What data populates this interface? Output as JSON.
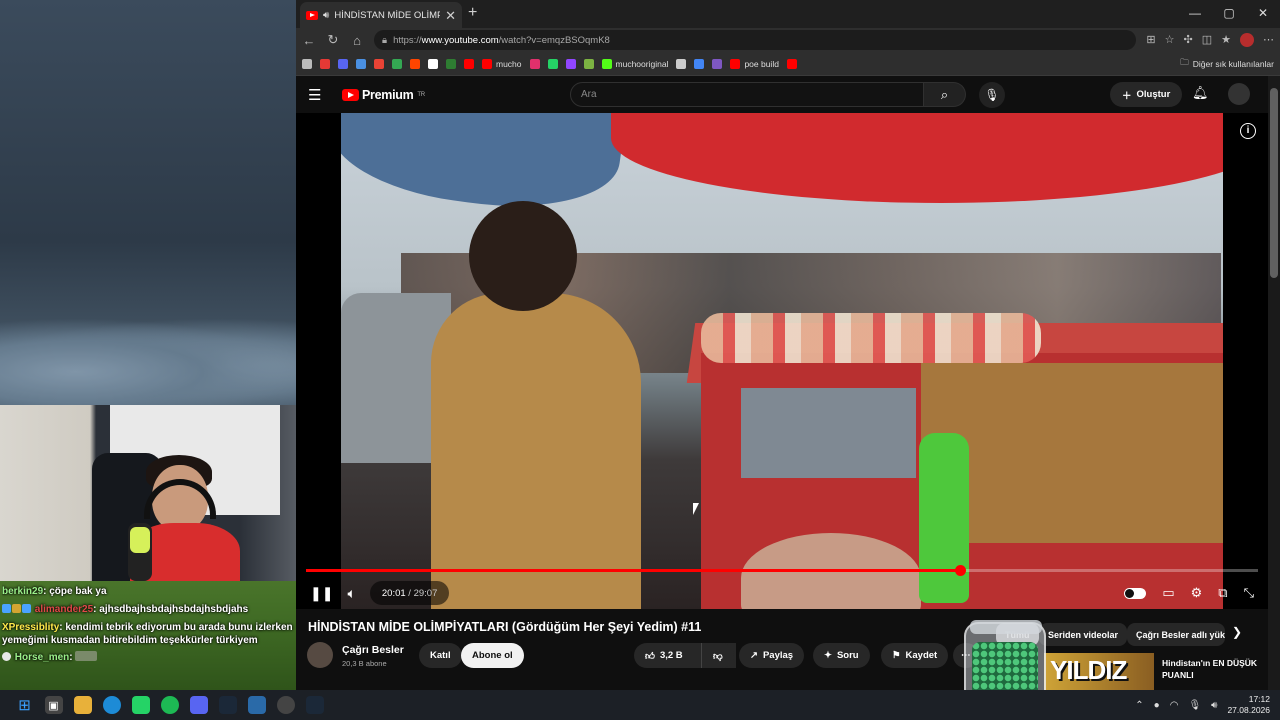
{
  "browser": {
    "tab_title": "HİNDİSTAN MİDE OLİMPİYATL",
    "tab_close": "✕",
    "new_tab": "+",
    "url_prefix": "https://",
    "url_domain": "www.youtube.com",
    "url_path": "/watch?v=emqzBSOqmK8",
    "bookmarks": [
      {
        "label": "",
        "color": "#bbbbbb"
      },
      {
        "label": "",
        "color": "#e53935"
      },
      {
        "label": "",
        "color": "#5865f2"
      },
      {
        "label": "",
        "color": "#4a90e2"
      },
      {
        "label": "",
        "color": "#ea4335"
      },
      {
        "label": "",
        "color": "#34a853"
      },
      {
        "label": "",
        "color": "#ff4500"
      },
      {
        "label": "",
        "color": "#ffffff"
      },
      {
        "label": "",
        "color": "#2e7d32"
      },
      {
        "label": "",
        "color": "#ff0000"
      },
      {
        "label": "mucho",
        "color": "#ff0000"
      },
      {
        "label": "",
        "color": "#e1306c"
      },
      {
        "label": "",
        "color": "#25d366"
      },
      {
        "label": "",
        "color": "#9146ff"
      },
      {
        "label": "",
        "color": "#7cb342"
      },
      {
        "label": "muchooriginal",
        "color": "#53fc18"
      },
      {
        "label": "",
        "color": "#cccccc"
      },
      {
        "label": "",
        "color": "#4285f4"
      },
      {
        "label": "",
        "color": "#7e57c2"
      },
      {
        "label": "poe build",
        "color": "#ff0000"
      },
      {
        "label": "",
        "color": "#ff0000"
      }
    ],
    "other_bookmarks": "Diğer sık kullanılanlar"
  },
  "youtube": {
    "logo": "Premium",
    "logo_region": "TR",
    "search_placeholder": "Ara",
    "create_label": "Oluştur",
    "video": {
      "current_time": "20:01",
      "duration": "29:07",
      "progress": 0.687,
      "title": "HİNDİSTAN MİDE OLİMPİYATLARI (Gördüğüm Her Şeyi Yedim) #11"
    },
    "channel": {
      "name": "Çağrı Besler",
      "subs": "20,3 B abone"
    },
    "buttons": {
      "join": "Katıl",
      "subscribe": "Abone ol",
      "likes": "3,2 B",
      "share": "Paylaş",
      "ask": "Soru",
      "save": "Kaydet"
    },
    "chips": [
      "Tümü",
      "Seriden videolar",
      "Çağrı Besler adlı yük"
    ],
    "recommendation": {
      "thumb_text": "YILDIZ",
      "title": "Hindistan'ın EN DÜŞÜK PUANLI"
    }
  },
  "chat": [
    {
      "user": "berkin29",
      "user_color": "#9bf08a",
      "text": "çöpe bak ya"
    },
    {
      "user": "alimander25",
      "user_color": "#e04848",
      "text": "ajhsdbajhsbdajhsbdajhsbdjahs"
    },
    {
      "user": "XPressiblity",
      "user_color": "#ffe84a",
      "text": "kendimi tebrik ediyorum bu arada bunu izlerken yemeğimi kusmadan bitirebildim teşekkürler türkiyem"
    },
    {
      "user": "Horse_men",
      "user_color": "#9bf08a",
      "text": ""
    }
  ],
  "taskbar": {
    "time": "17:12",
    "date": "27.08.2026"
  }
}
